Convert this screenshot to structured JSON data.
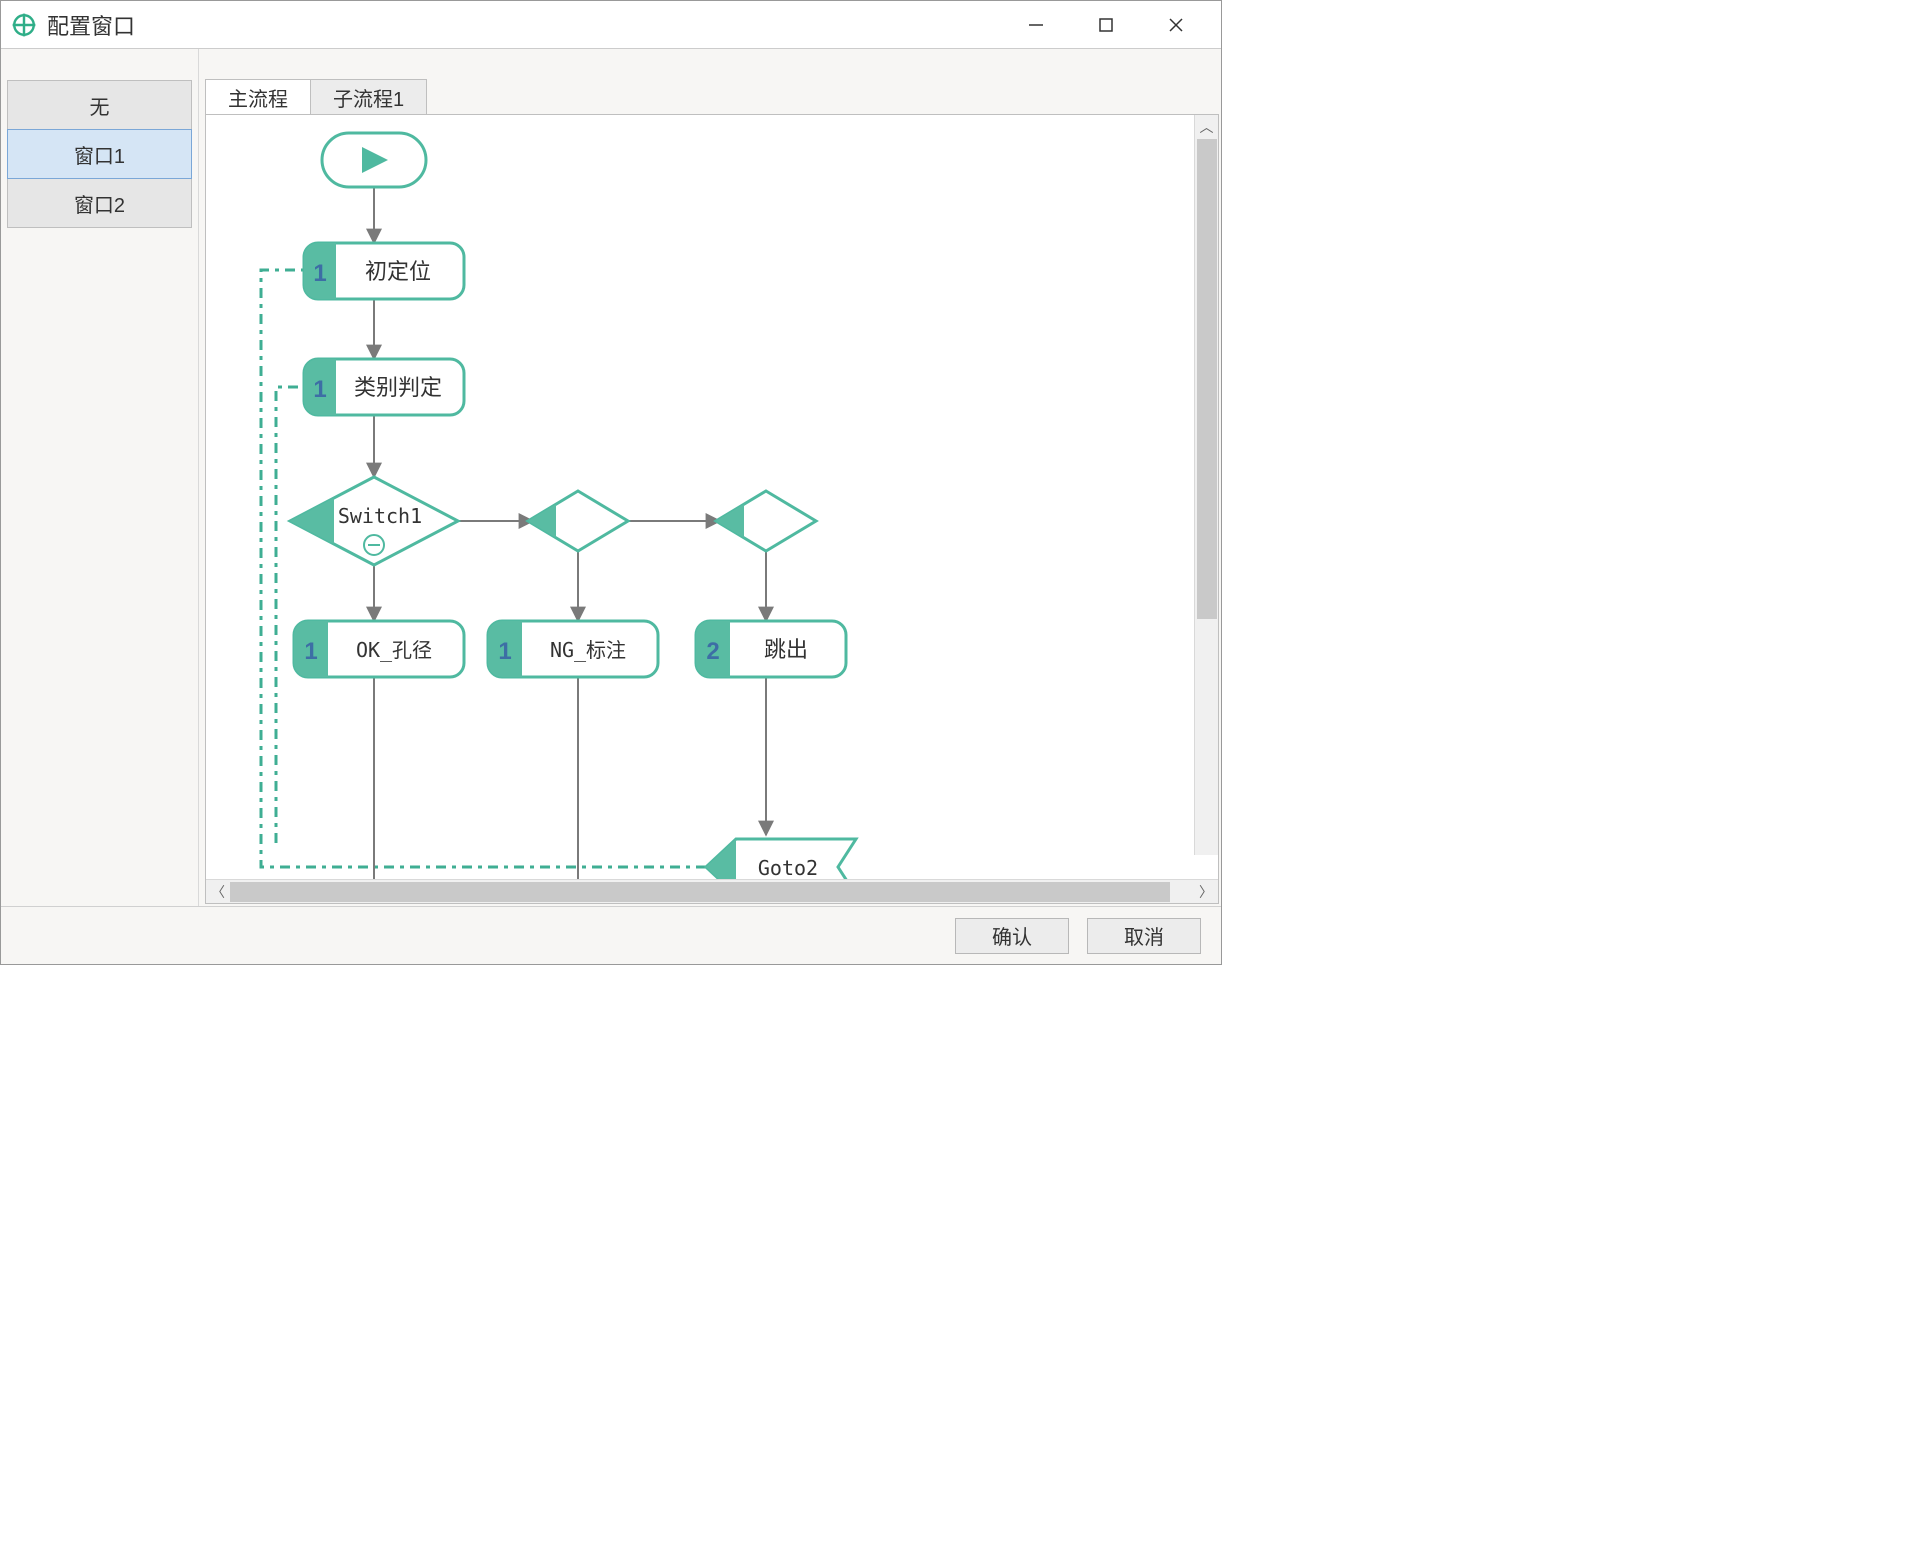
{
  "window": {
    "title": "配置窗口"
  },
  "sidebar": {
    "items": [
      {
        "label": "无",
        "selected": false
      },
      {
        "label": "窗口1",
        "selected": true
      },
      {
        "label": "窗口2",
        "selected": false
      }
    ]
  },
  "tabs": [
    {
      "label": "主流程",
      "active": true
    },
    {
      "label": "子流程1",
      "active": false
    }
  ],
  "flow": {
    "start": {
      "type": "start"
    },
    "nodes": [
      {
        "id": "n1",
        "badge": "1",
        "label": "初定位"
      },
      {
        "id": "n2",
        "badge": "1",
        "label": "类别判定"
      },
      {
        "id": "switch",
        "type": "switch",
        "label": "Switch1",
        "branches": [
          "2",
          "3"
        ]
      },
      {
        "id": "b1",
        "badge": "1",
        "label": "OK_孔径"
      },
      {
        "id": "b2",
        "badge": "1",
        "label": "NG_标注"
      },
      {
        "id": "b3",
        "badge": "2",
        "label": "跳出"
      },
      {
        "id": "goto",
        "type": "goto",
        "label": "Goto2"
      }
    ]
  },
  "buttons": {
    "ok": "确认",
    "cancel": "取消"
  },
  "colors": {
    "accent": "#4fb9a0",
    "accentFill": "#59bca3",
    "nodeBorder": "#4fb9a0",
    "badgeText": "#3d6ea5",
    "arrow": "#7a7a7a",
    "dashed": "#3fae93"
  }
}
